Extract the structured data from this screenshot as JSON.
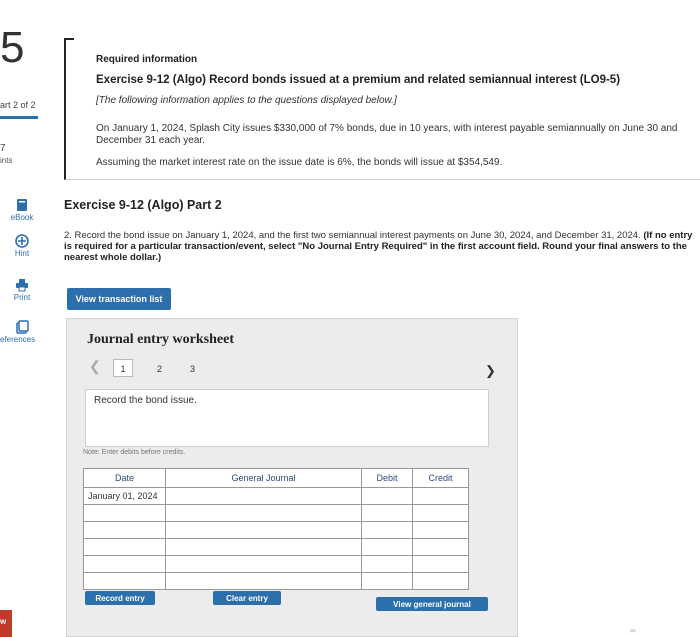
{
  "sidebar": {
    "question_number": "5",
    "part_label": "art 2 of 2",
    "points_value": "7",
    "points_label": "ints",
    "tools": [
      {
        "label": "eBook",
        "icon": "book-icon"
      },
      {
        "label": "Hint",
        "icon": "hint-icon"
      },
      {
        "label": "Print",
        "icon": "print-icon"
      },
      {
        "label": "eferences",
        "icon": "references-icon"
      }
    ],
    "mw_badge": "w"
  },
  "info": {
    "required": "Required information",
    "title": "Exercise 9-12 (Algo) Record bonds issued at a premium and related semiannual interest (LO9-5)",
    "note": "[The following information applies to the questions displayed below.]",
    "para1": "On January 1, 2024, Splash City issues $330,000 of 7% bonds, due in 10 years, with interest payable semiannually on June 30 and December 31 each year.",
    "para2": "Assuming the market interest rate on the issue date is 6%, the bonds will issue at $354,549."
  },
  "part": {
    "title": "Exercise 9-12 (Algo) Part 2",
    "instruction_plain": "2. Record the bond issue on January 1, 2024, and the first two semiannual interest payments on June 30, 2024, and December 31, 2024.",
    "instruction_bold": "(If no entry is required for a particular transaction/event, select \"No Journal Entry Required\" in the first account field. Round your final answers to the nearest whole dollar.)"
  },
  "view_transaction_label": "View transaction list",
  "worksheet": {
    "title": "Journal entry worksheet",
    "pages": [
      "1",
      "2",
      "3"
    ],
    "current_page": "1",
    "prompt": "Record the bond issue.",
    "note": "Note: Enter debits before credits.",
    "columns": {
      "date": "Date",
      "journal": "General Journal",
      "debit": "Debit",
      "credit": "Credit"
    },
    "rows": [
      {
        "date": "January 01, 2024",
        "account": "",
        "debit": "",
        "credit": ""
      },
      {
        "date": "",
        "account": "",
        "debit": "",
        "credit": ""
      },
      {
        "date": "",
        "account": "",
        "debit": "",
        "credit": ""
      },
      {
        "date": "",
        "account": "",
        "debit": "",
        "credit": ""
      },
      {
        "date": "",
        "account": "",
        "debit": "",
        "credit": ""
      },
      {
        "date": "",
        "account": "",
        "debit": "",
        "credit": ""
      }
    ],
    "record_label": "Record entry",
    "clear_label": "Clear entry",
    "view_journal_label": "View general journal"
  },
  "colors": {
    "accent": "#2c6fad",
    "panel_bg": "#ececec"
  }
}
